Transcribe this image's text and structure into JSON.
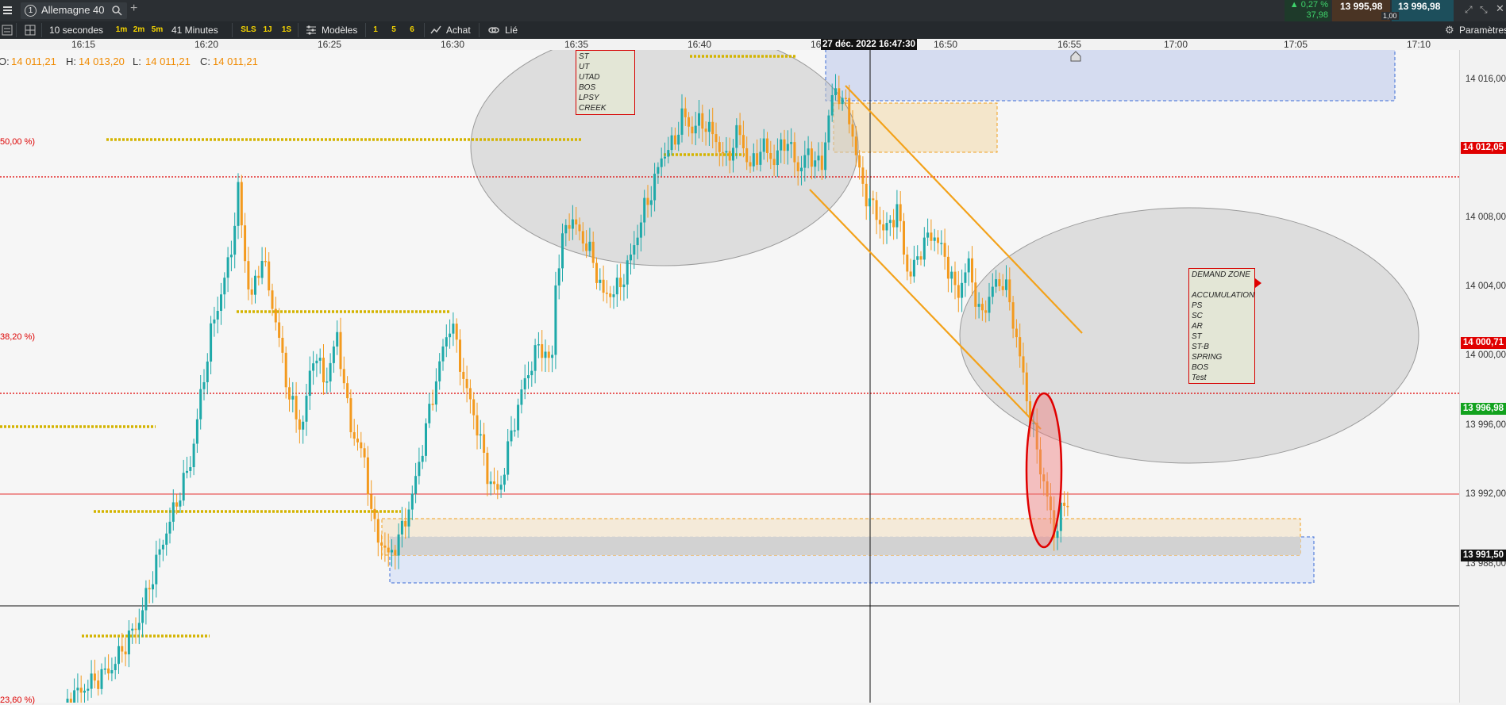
{
  "topbar": {
    "tab_number": "1",
    "instrument": "Allemagne 40",
    "change_pct": "▲ 0,27 %",
    "change_abs": "37,98",
    "bid": "13 995,98",
    "ask": "13 996,98",
    "spread": "1,00"
  },
  "toolbar": {
    "interval": "10 secondes",
    "tf_1m": "1m",
    "tf_2m": "2m",
    "tf_5m": "5m",
    "duration": "41 Minutes",
    "sls": "SLS",
    "tf_1j": "1J",
    "tf_1s": "1S",
    "models": "Modèles",
    "n1": "1",
    "n5": "5",
    "n6": "6",
    "achat": "Achat",
    "lie": "Lié",
    "params": "Paramètres"
  },
  "time_axis": [
    "16:15",
    "16:20",
    "16:25",
    "16:30",
    "16:35",
    "16:40",
    "16:45",
    "16:50",
    "16:55",
    "17:00",
    "17:05",
    "17:10"
  ],
  "crosshair_time": "27 déc. 2022 16:47:30",
  "ohlc": {
    "o_label": "O:",
    "o": "14 011,21",
    "h_label": "H:",
    "h": "14 013,20",
    "l_label": "L:",
    "l": "14 011,21",
    "c_label": "C:",
    "c": "14 011,21"
  },
  "fib": {
    "f50": "50,00 %)",
    "f38": "38,20 %)",
    "f23": "23,60 %)"
  },
  "price_axis": [
    "14 016,00",
    "14 012,00",
    "14 008,00",
    "14 004,00",
    "14 000,00",
    "13 996,00",
    "13 992,00",
    "13 988,00"
  ],
  "price_tags": {
    "p1": "14 012,05",
    "p2": "14 000,71",
    "current": "13 996,98",
    "cursor": "13 991,50"
  },
  "top_panel": [
    "ST",
    "UT",
    "UTAD",
    "BOS",
    "LPSY",
    "CREEK"
  ],
  "demand_panel": [
    "DEMAND ZONE",
    "",
    "ACCUMULATION",
    "PS",
    "SC",
    "AR",
    "ST",
    "ST-B",
    "SPRING",
    "BOS",
    "Test"
  ],
  "colors": {
    "up": "#1ea9a9",
    "down": "#f39a1e",
    "fib": "#e00000",
    "level": "#d4b400",
    "current": "#00a51c"
  }
}
